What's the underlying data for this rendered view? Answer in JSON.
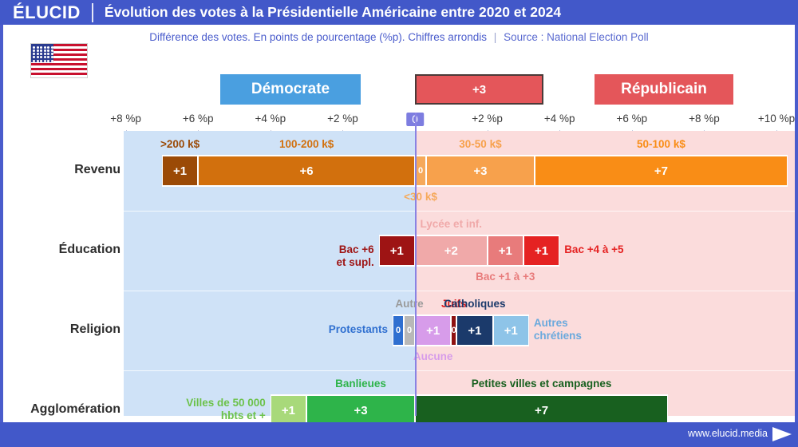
{
  "header": {
    "logo": "ÉLUCID",
    "title": "Évolution des votes à la Présidentielle Américaine entre 2020 et 2024"
  },
  "subtitle": {
    "main": "Différence des votes. En points de pourcentage (%p). Chiffres arrondis",
    "separator": "|",
    "source": "Source : National Election Poll"
  },
  "legend": {
    "democrat": "Démocrate",
    "value_example": "+3",
    "republican": "Républicain"
  },
  "footer": {
    "url": "www.elucid.media"
  },
  "colors": {
    "header_blue": "#4258c9",
    "democrat_blue": "#4a9fe0",
    "republican_red": "#e4565a",
    "band_dem": "#cfe2f7",
    "band_rep": "#fbdcdc",
    "zero_line": "#8a83e3"
  },
  "chart_data": {
    "type": "bar",
    "title": "Évolution des votes à la Présidentielle Américaine entre 2020 et 2024",
    "subtitle": "Différence des votes. En points de pourcentage (%p). Chiffres arrondis",
    "source": "Source : National Election Poll",
    "xlabel": "",
    "ylabel": "",
    "orientation": "horizontal-diverging",
    "unit": "%p",
    "axis": {
      "ticks": [
        {
          "label": "+8 %p",
          "value": -8
        },
        {
          "label": "+6 %p",
          "value": -6
        },
        {
          "label": "+4 %p",
          "value": -4
        },
        {
          "label": "+2 %p",
          "value": -2
        },
        {
          "label": "0",
          "value": 0
        },
        {
          "label": "+2 %p",
          "value": 2
        },
        {
          "label": "+4 %p",
          "value": 4
        },
        {
          "label": "+6 %p",
          "value": 6
        },
        {
          "label": "+8 %p",
          "value": 8
        },
        {
          "label": "+10 %p",
          "value": 10
        }
      ],
      "xlim": [
        -8.8,
        10.5
      ],
      "grid": false,
      "left_side": "Démocrate",
      "right_side": "Républicain"
    },
    "legend": [
      "Démocrate",
      "Républicain"
    ],
    "rows": [
      {
        "label": "Revenu",
        "segments": [
          {
            "category": ">200 k$",
            "value": 1,
            "label": "+1",
            "color": "#9b4a06",
            "label_color": "#9b4a06",
            "side": "dem",
            "label_pos": "above"
          },
          {
            "category": "100-200 k$",
            "value": 6,
            "label": "+6",
            "color": "#d2700d",
            "label_color": "#d2700d",
            "side": "dem",
            "label_pos": "above"
          },
          {
            "category": "<30 k$",
            "value": 0,
            "label": "0",
            "color": "#f6a95a",
            "label_color": "#f6a95a",
            "side": "rep",
            "label_pos": "below"
          },
          {
            "category": "30-50 k$",
            "value": 3,
            "label": "+3",
            "color": "#f7a14c",
            "label_color": "#f7a14c",
            "side": "rep",
            "label_pos": "above"
          },
          {
            "category": "50-100 k$",
            "value": 7,
            "label": "+7",
            "color": "#f98d16",
            "label_color": "#f98d16",
            "side": "rep",
            "label_pos": "above"
          }
        ]
      },
      {
        "label": "Éducation",
        "segments": [
          {
            "category": "Bac +6 et supl.",
            "value": 1,
            "label": "+1",
            "color": "#9e1414",
            "label_color": "#9e1414",
            "side": "dem",
            "label_pos": "left"
          },
          {
            "category": "Lycée et inf.",
            "value": 2,
            "label": "+2",
            "color": "#f0a9a9",
            "label_color": "#f0a9a9",
            "side": "rep",
            "label_pos": "above"
          },
          {
            "category": "Bac +1 à +3",
            "value": 1,
            "label": "+1",
            "color": "#e87b7b",
            "label_color": "#e87b7b",
            "side": "rep",
            "label_pos": "below"
          },
          {
            "category": "Bac +4 à +5",
            "value": 1,
            "label": "+1",
            "color": "#e52222",
            "label_color": "#e52222",
            "side": "rep",
            "label_pos": "right"
          }
        ]
      },
      {
        "label": "Religion",
        "segments": [
          {
            "category": "Protestants",
            "value": 0,
            "label": "0",
            "color": "#2f6fd0",
            "label_color": "#2f6fd0",
            "side": "dem",
            "label_pos": "left"
          },
          {
            "category": "Autre",
            "value": 0,
            "label": "0",
            "color": "#b8b8b8",
            "label_color": "#9a9a9a",
            "side": "dem",
            "label_pos": "above"
          },
          {
            "category": "Aucune",
            "value": 1,
            "label": "+1",
            "color": "#d79cea",
            "label_color": "#d79cea",
            "side": "rep",
            "label_pos": "below"
          },
          {
            "category": "Juifs",
            "value": 0,
            "label": "0",
            "color": "#8e1111",
            "label_color": "#e02020",
            "side": "rep",
            "label_pos": "above"
          },
          {
            "category": "Catholiques",
            "value": 1,
            "label": "+1",
            "color": "#1b3a6b",
            "label_color": "#1b3a6b",
            "side": "rep",
            "label_pos": "above"
          },
          {
            "category": "Autres chrétiens",
            "value": 1,
            "label": "+1",
            "color": "#8ec4e8",
            "label_color": "#6aa9dd",
            "side": "rep",
            "label_pos": "right"
          }
        ]
      },
      {
        "label": "Agglomération",
        "segments": [
          {
            "category": "Villes de 50 000 hbts et +",
            "value": 1,
            "label": "+1",
            "color": "#a8d97a",
            "label_color": "#6cc24a",
            "side": "dem",
            "label_pos": "left"
          },
          {
            "category": "Banlieues",
            "value": 3,
            "label": "+3",
            "color": "#2eb44a",
            "label_color": "#2eb44a",
            "side": "dem",
            "label_pos": "above"
          },
          {
            "category": "Petites villes et campagnes",
            "value": 7,
            "label": "+7",
            "color": "#18601f",
            "label_color": "#18601f",
            "side": "rep",
            "label_pos": "above"
          }
        ]
      }
    ]
  }
}
